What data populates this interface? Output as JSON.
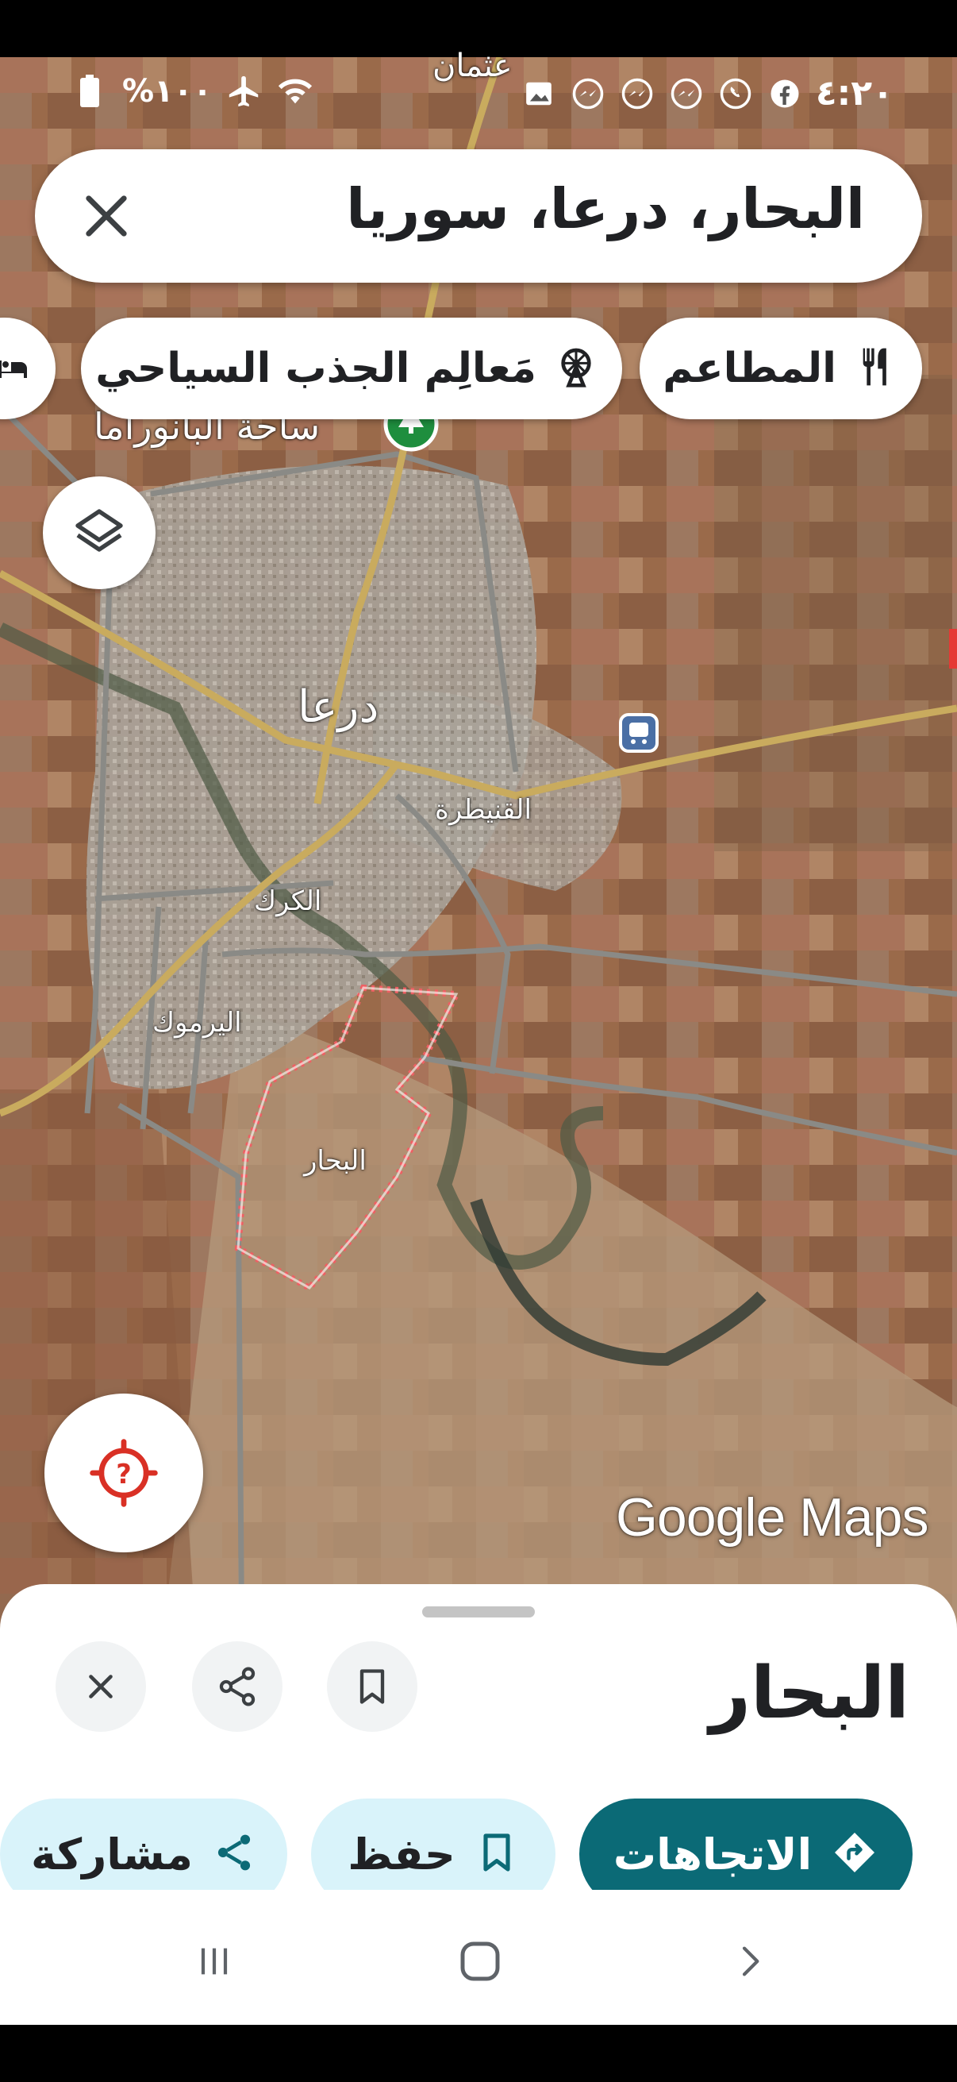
{
  "status_bar": {
    "time": "٤:٢٠",
    "battery": "%١٠٠",
    "icons_right": [
      "facebook-icon",
      "whatsapp-icon",
      "messenger-icon",
      "messenger-icon",
      "messenger-icon",
      "gallery-icon"
    ],
    "icons_left": [
      "battery-icon",
      "airplane-icon",
      "wifi-icon"
    ]
  },
  "search": {
    "query": "البحار، درعا، سوريا"
  },
  "chips": [
    {
      "label": "المطاعم",
      "icon": "fork-knife-icon"
    },
    {
      "label": "مَعالِم الجذب السياحي",
      "icon": "ferris-wheel-icon"
    }
  ],
  "map": {
    "labels": {
      "city": "درعا",
      "north": "عثمان",
      "panorama": "ساحة البانوراما",
      "quneitra": "القنيطرة",
      "karak": "الكرك",
      "yarmouk": "اليرموك",
      "bahar": "البحار"
    },
    "watermark": "Google Maps",
    "colors": {
      "boundary": "#ee5f63",
      "park_pin": "#1e8e3e",
      "road_major": "#c9ab5e",
      "road_minor": "#8a8a86",
      "transit": "#4a6fa5"
    }
  },
  "sheet": {
    "title": "البحار",
    "actions": {
      "directions": "الاتجاهات",
      "save": "حفظ",
      "share": "مشاركة"
    },
    "accent": "#0b6a76"
  },
  "nav": [
    "recents-icon",
    "home-icon",
    "back-icon"
  ]
}
